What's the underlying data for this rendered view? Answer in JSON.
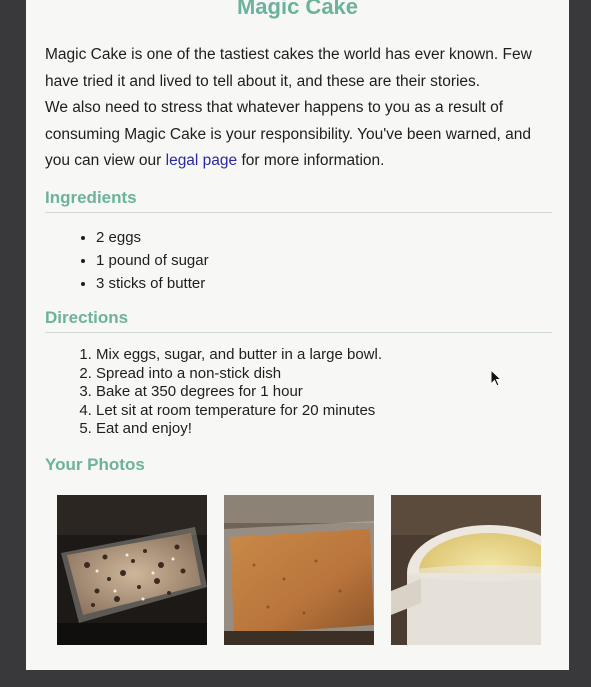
{
  "article": {
    "title": "Magic Cake",
    "intro_p1": "Magic Cake is one of the tastiest cakes the world has ever known. Few have tried it and lived to tell about it, and these are their stories.",
    "intro_p2_before_link": "We also need to stress that whatever happens to you as a result of consuming Magic Cake is your responsibility. You've been warned, and you can view our ",
    "legal_link": "legal page",
    "intro_p2_after_link": " for more information."
  },
  "ingredients": {
    "heading": "Ingredients",
    "items": [
      "2 eggs",
      "1 pound of sugar",
      "3 sticks of butter"
    ]
  },
  "directions": {
    "heading": "Directions",
    "steps": [
      "Mix eggs, sugar, and butter in a large bowl.",
      "Spread into a non-stick dish",
      "Bake at 350 degrees for 1 hour",
      "Let sit at room temperature for 20 minutes",
      "Eat and enjoy!"
    ]
  },
  "photos": {
    "heading": "Your Photos",
    "items": [
      "cake-in-dish-photo",
      "baked-cake-photo",
      "batter-cup-photo"
    ]
  },
  "colors": {
    "heading": "#6db29a",
    "link": "#2a2a9e",
    "page_bg": "#f7f7f6",
    "frame_bg": "#39393c"
  }
}
